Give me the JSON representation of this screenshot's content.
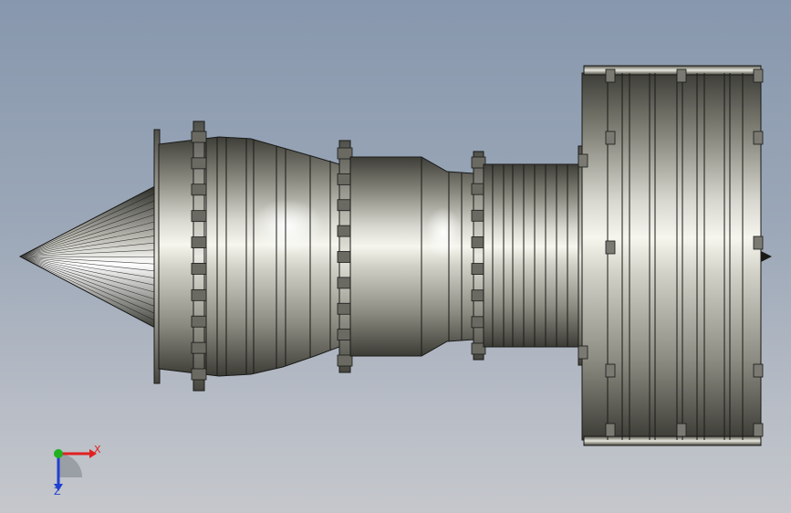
{
  "viewport": {
    "name": "3d-model-viewport",
    "model": "turbofan-engine-side-view"
  },
  "triad": {
    "x_label": "X",
    "z_label": "Z",
    "colors": {
      "x": "#e02020",
      "y": "#20b020",
      "z": "#2040d0"
    }
  },
  "colors": {
    "metal_dark": "#4a4a44",
    "metal_mid": "#9a9a90",
    "metal_light": "#f4f4ec",
    "edge": "#1a1a18"
  }
}
